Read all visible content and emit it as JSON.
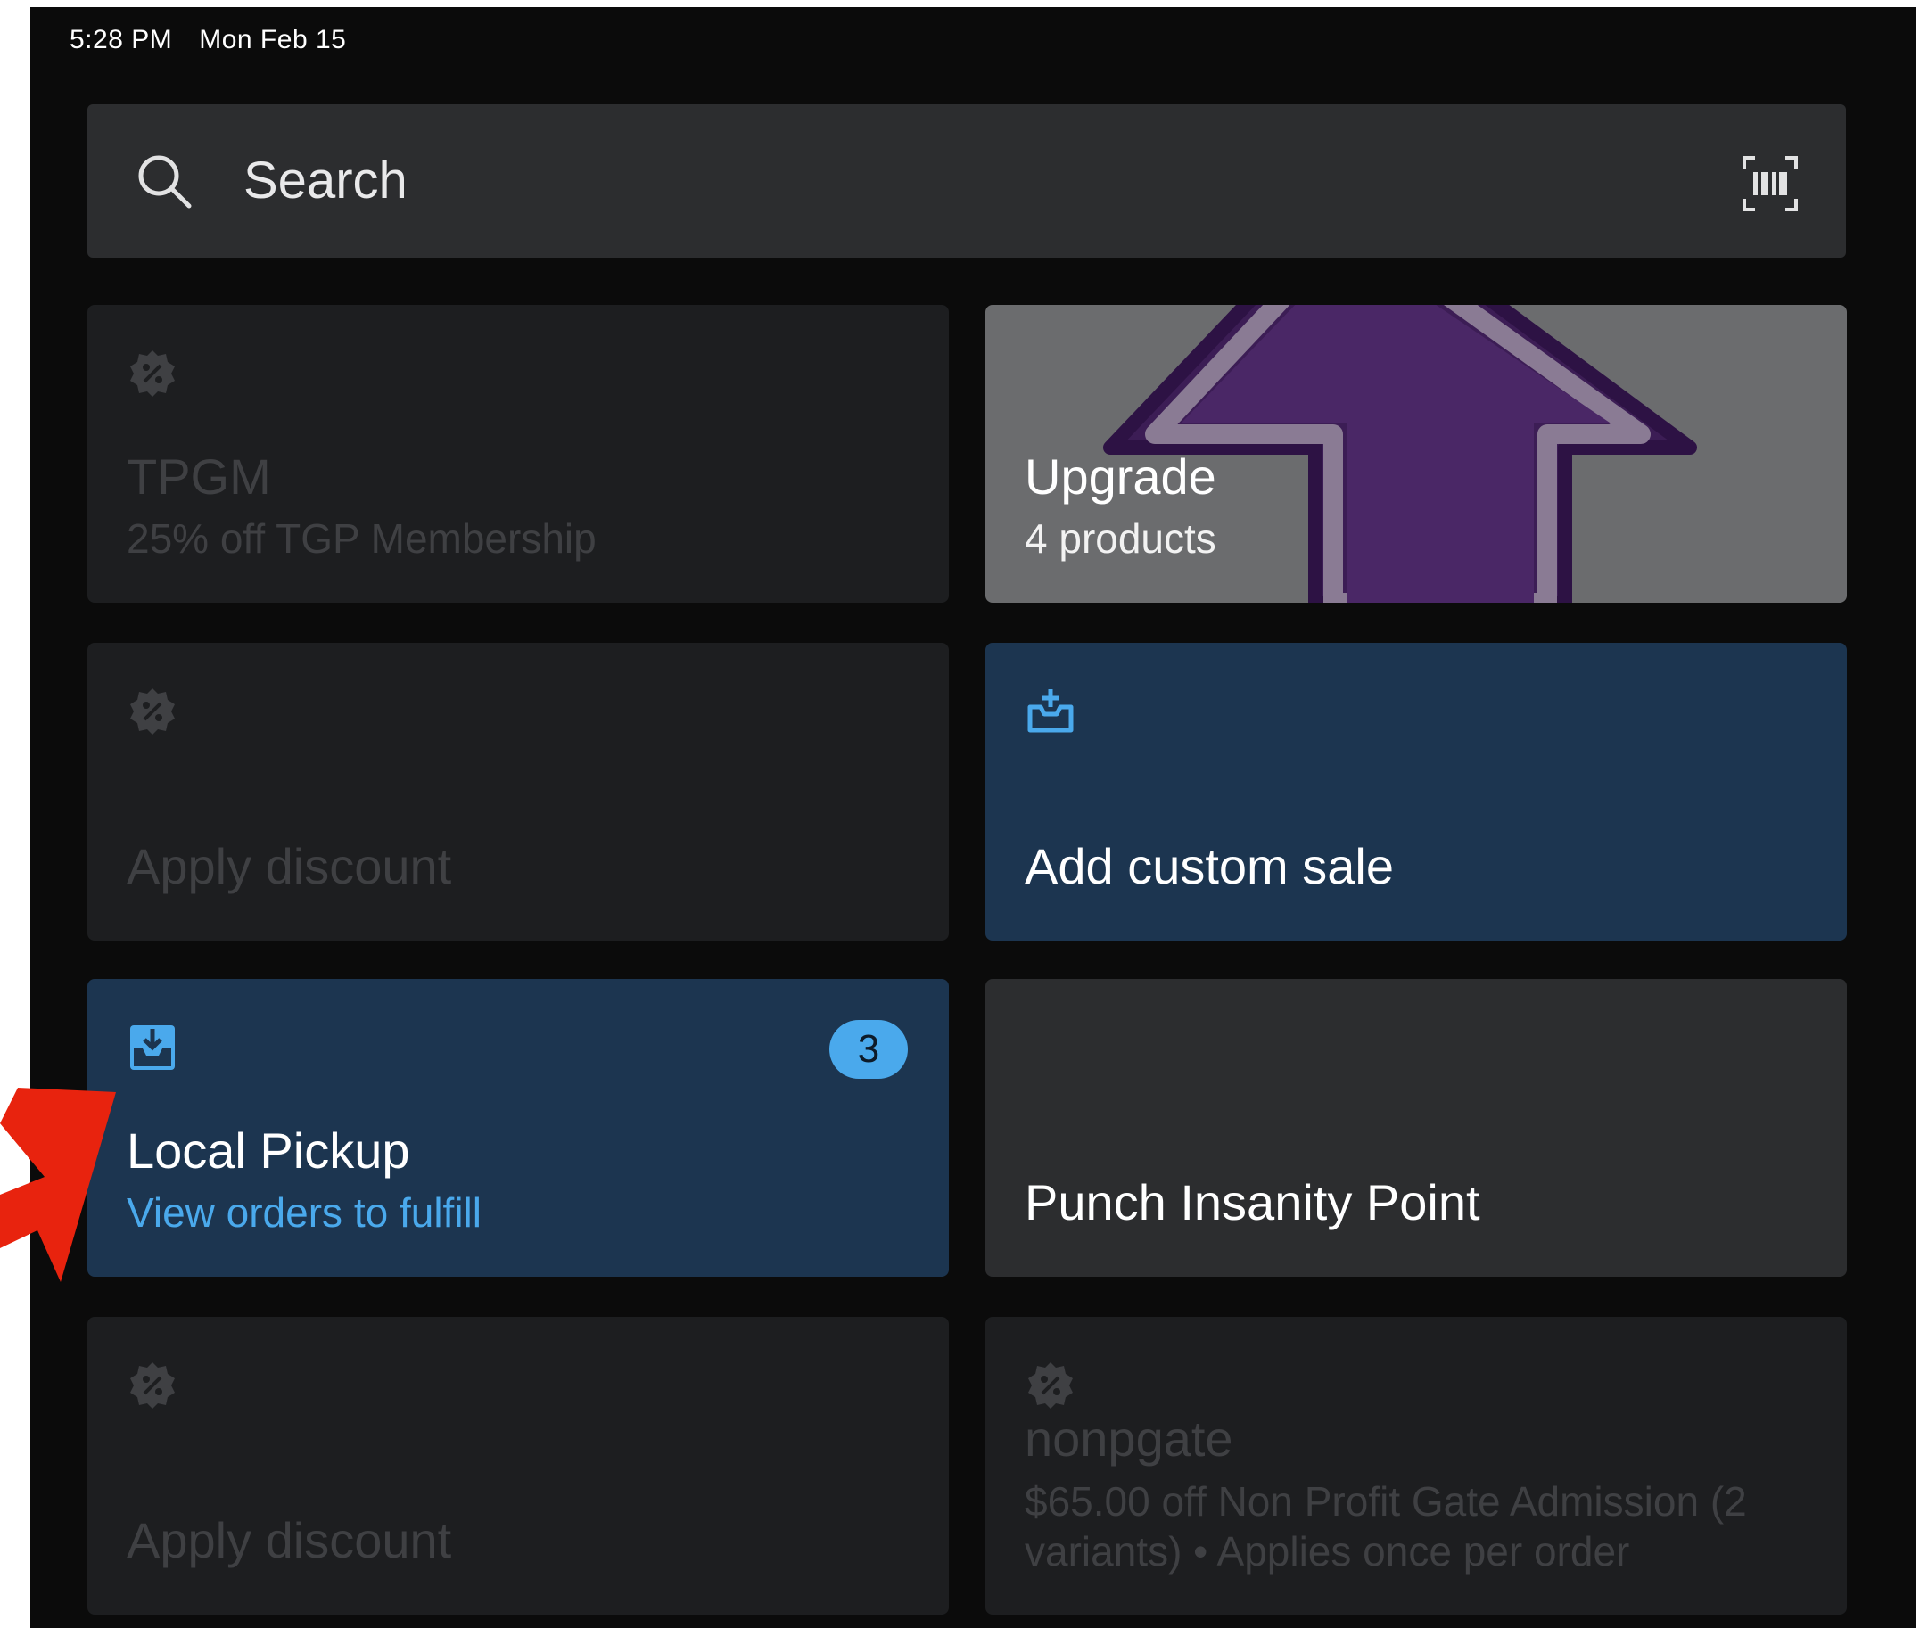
{
  "status_bar": {
    "time": "5:28 PM",
    "date": "Mon Feb 15"
  },
  "search": {
    "placeholder": "Search",
    "search_icon": "search-icon",
    "barcode_icon": "barcode-scan-icon"
  },
  "tiles": {
    "tpgm": {
      "icon": "discount-badge-icon",
      "title": "TPGM",
      "subtitle": "25% off TGP Membership",
      "state": "disabled"
    },
    "upgrade": {
      "title": "Upgrade",
      "subtitle": "4 products",
      "art": "purple-up-arrow"
    },
    "apply_discount_1": {
      "icon": "discount-badge-icon",
      "title": "Apply discount",
      "state": "disabled"
    },
    "custom_sale": {
      "icon": "tray-upload-icon",
      "title": "Add custom sale"
    },
    "local_pickup": {
      "icon": "tray-download-icon",
      "title": "Local Pickup",
      "subtitle": "View orders to fulfill",
      "badge": "3"
    },
    "punch": {
      "title": "Punch Insanity Point"
    },
    "apply_discount_2": {
      "icon": "discount-badge-icon",
      "title": "Apply discount",
      "state": "disabled"
    },
    "nonpgate": {
      "icon": "discount-badge-icon",
      "title": "nonpgate",
      "subtitle_line1": "$65.00 off Non Profit Gate Admission (2",
      "subtitle_line2": "variants) • Applies once per order",
      "state": "disabled"
    }
  },
  "colors": {
    "background": "#0b0b0b",
    "accent_blue": "#4aa9ec",
    "blue_tile": "#1c3550",
    "annotation_red": "#e8230e"
  }
}
